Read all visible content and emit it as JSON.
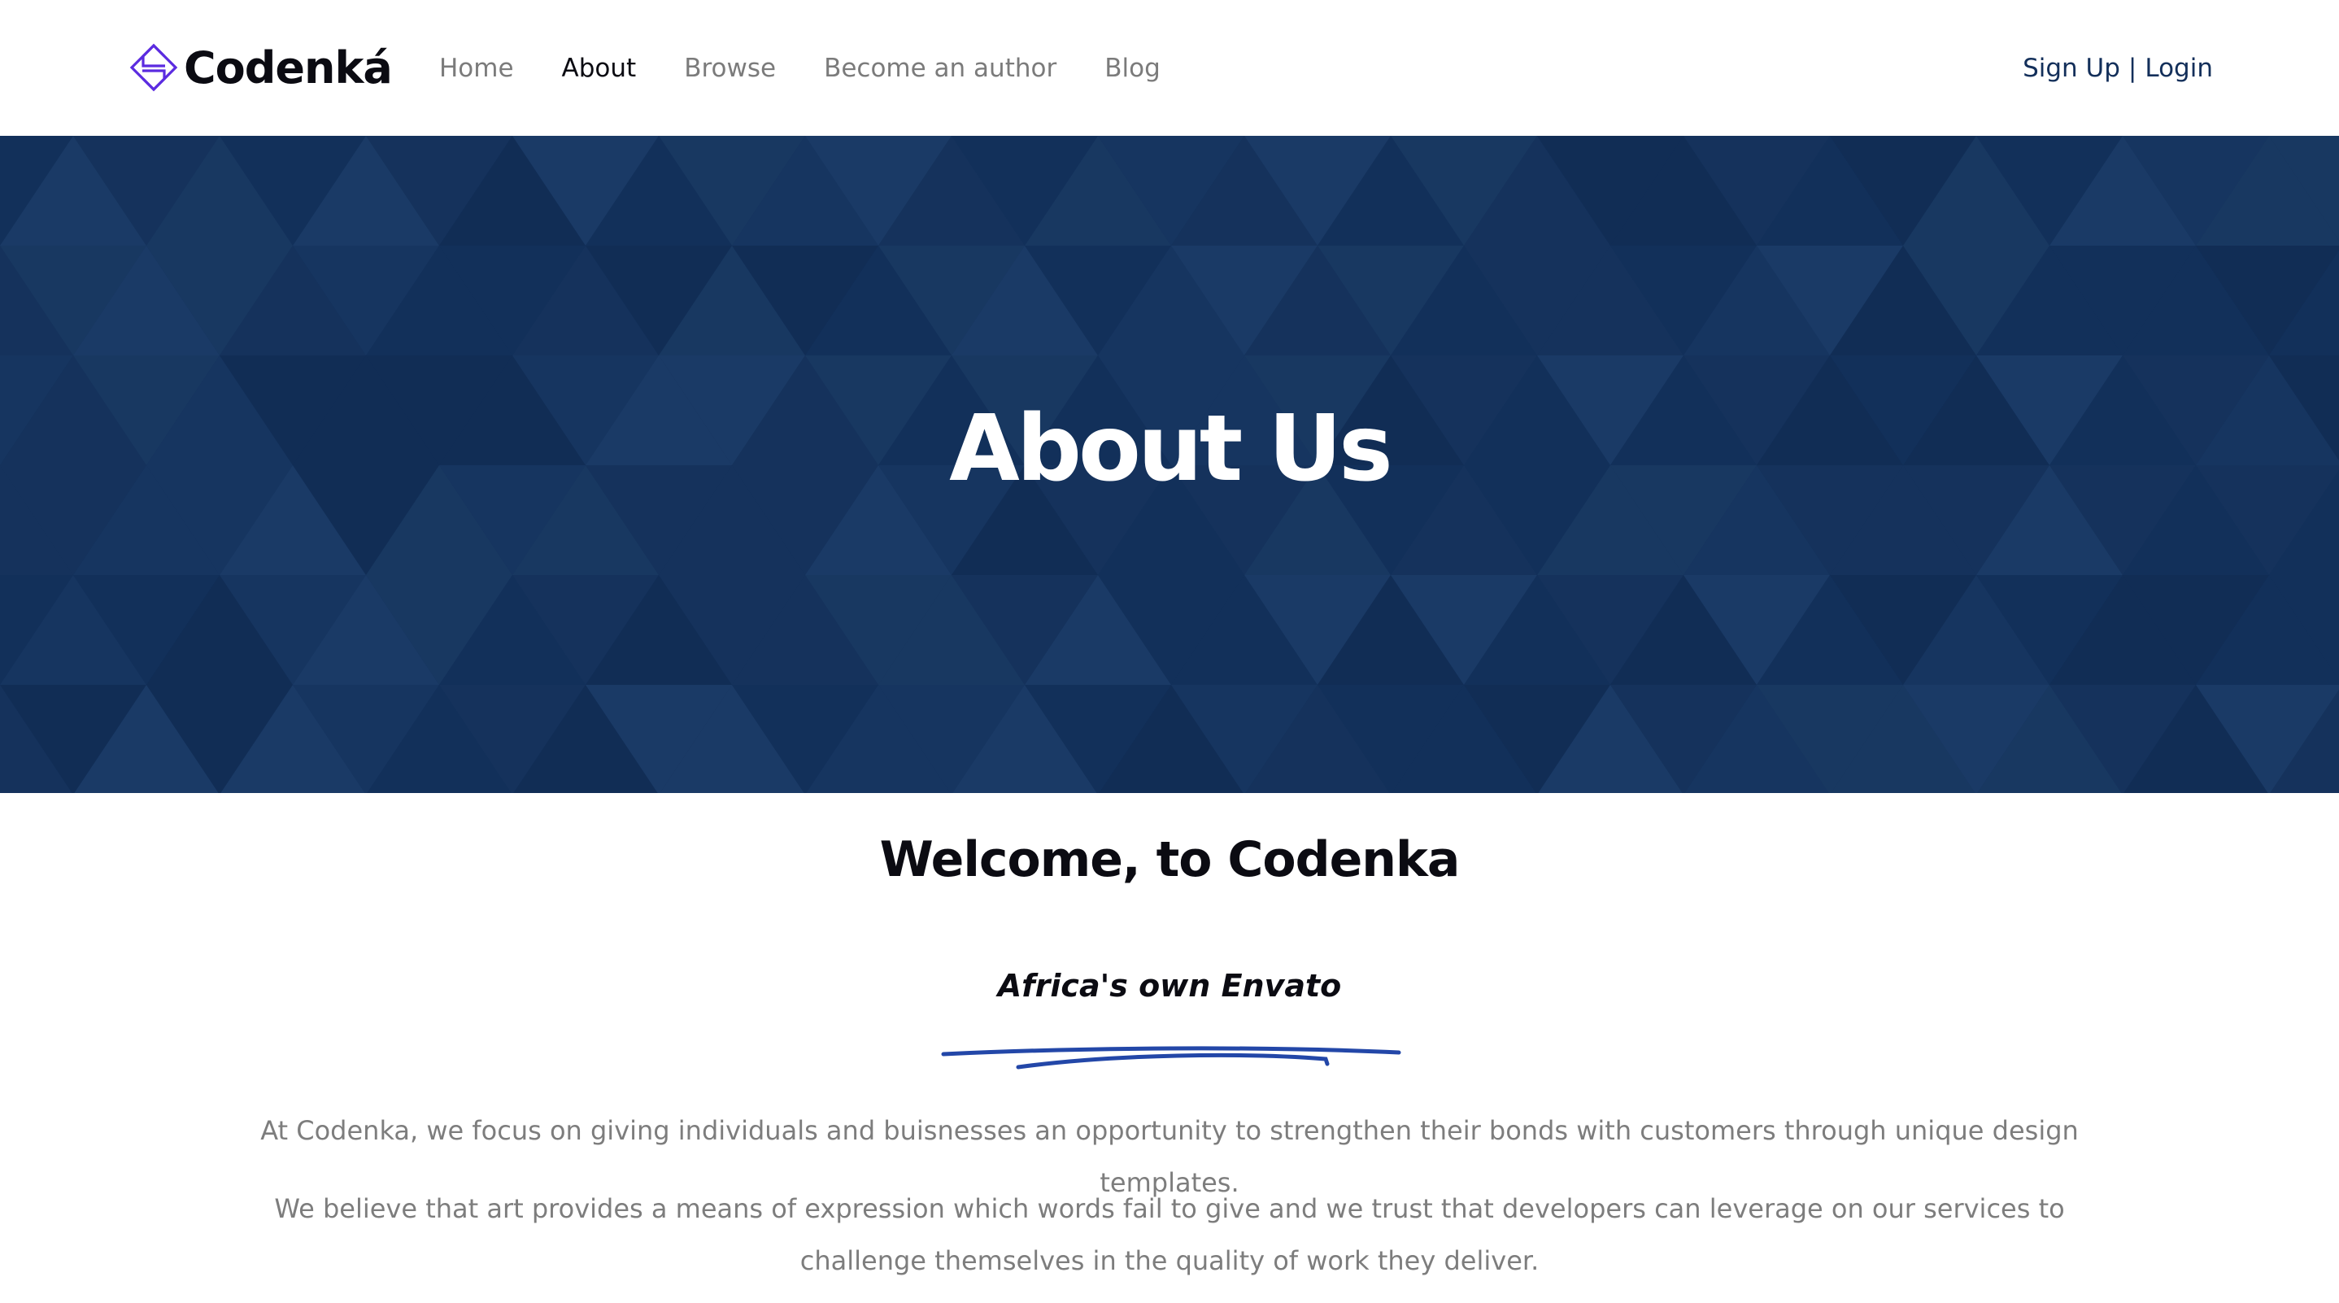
{
  "brand": {
    "name": "Codenká",
    "logo_icon": "codenka-logo-icon",
    "logo_color": "#5b2be0"
  },
  "nav": {
    "items": [
      {
        "label": "Home",
        "active": false
      },
      {
        "label": "About",
        "active": true
      },
      {
        "label": "Browse",
        "active": false
      },
      {
        "label": "Become an author",
        "active": false
      },
      {
        "label": "Blog",
        "active": false
      }
    ]
  },
  "auth": {
    "signup_label": "Sign Up",
    "separator": "|",
    "login_label": "Login"
  },
  "hero": {
    "title": "About Us",
    "background_color": "#15325c"
  },
  "content": {
    "heading": "Welcome, to Codenka",
    "tagline": "Africa's own Envato",
    "underline_color": "#2347a8",
    "paragraph_1": "At Codenka, we focus on giving individuals and buisnesses an opportunity to strengthen their bonds with customers through unique design templates.",
    "paragraph_2": "We believe that art provides a means of expression which words fail to give and we trust that developers can leverage on our services to challenge themselves in the quality of work they deliver."
  }
}
